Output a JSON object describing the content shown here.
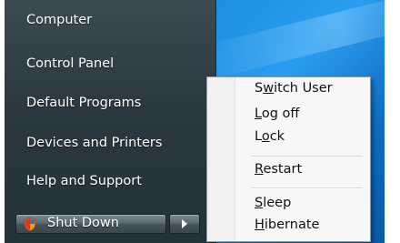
{
  "start_menu": {
    "right_pane_items": [
      {
        "label": "Computer"
      },
      {
        "label": "Control Panel"
      },
      {
        "label": "Default Programs"
      },
      {
        "label": "Devices and Printers"
      },
      {
        "label": "Help and Support"
      }
    ],
    "shutdown_button": {
      "label": "Shut Down",
      "icon": "uac-shield-icon"
    },
    "shutdown_options_button": {
      "icon": "arrow-right-icon"
    }
  },
  "shutdown_menu": {
    "items": [
      {
        "pre": "S",
        "key": "w",
        "post": "itch User"
      },
      {
        "pre": "",
        "key": "L",
        "post": "og off"
      },
      {
        "pre": "L",
        "key": "o",
        "post": "ck"
      },
      {
        "pre": "",
        "key": "R",
        "post": "estart"
      },
      {
        "pre": "",
        "key": "S",
        "post": "leep"
      },
      {
        "pre": "",
        "key": "H",
        "post": "ibernate"
      }
    ]
  },
  "colors": {
    "panel": "#2b383f",
    "desktop": "#1c8fe0",
    "menu_bg": "#f7f7f8",
    "shield_orange": "#f0a020",
    "shield_red": "#d83a1a"
  }
}
